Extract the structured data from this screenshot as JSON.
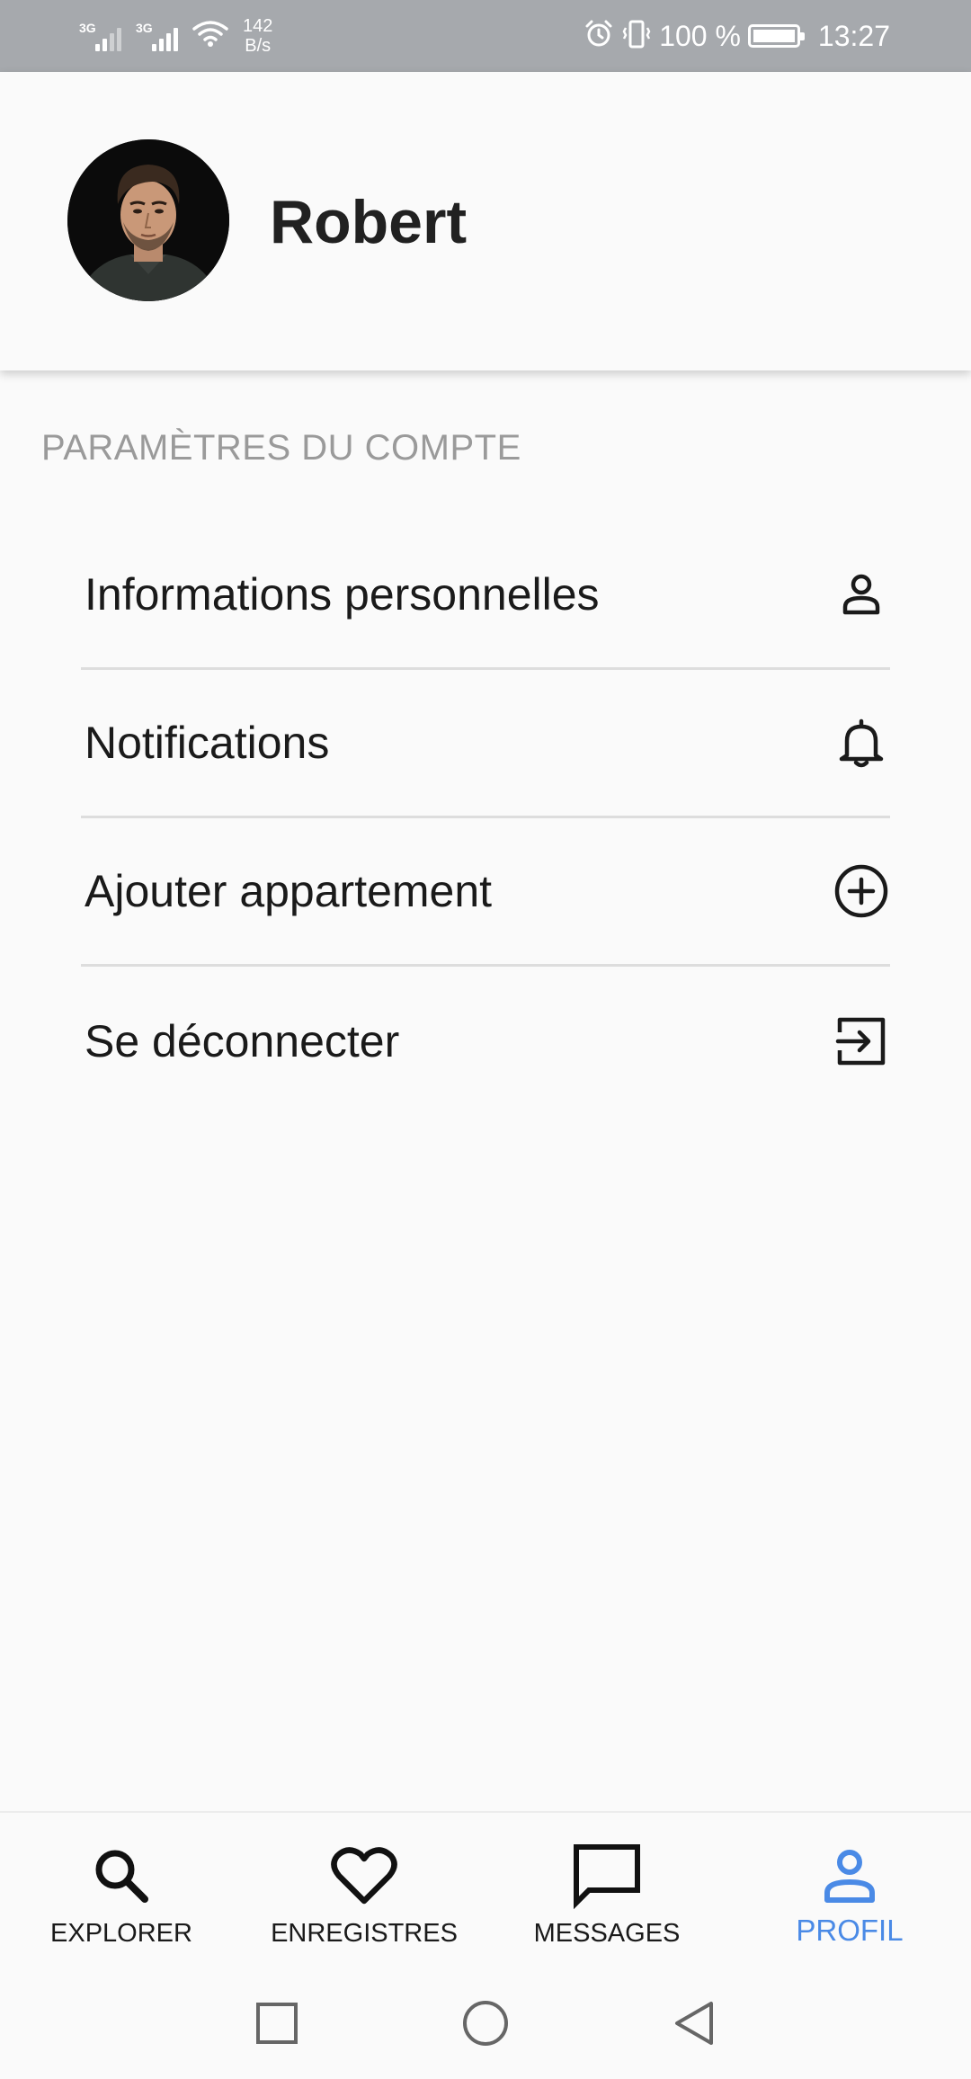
{
  "status_bar": {
    "net_type_1": "3G",
    "net_type_2": "3G",
    "net_speed_value": "142",
    "net_speed_unit": "B/s",
    "battery_percent": "100 %",
    "time": "13:27"
  },
  "profile": {
    "name": "Robert"
  },
  "account_section": {
    "title": "PARAMÈTRES DU COMPTE",
    "items": [
      {
        "label": "Informations personnelles",
        "icon": "person-icon"
      },
      {
        "label": "Notifications",
        "icon": "bell-icon"
      },
      {
        "label": "Ajouter appartement",
        "icon": "add-circle-icon"
      },
      {
        "label": "Se déconnecter",
        "icon": "logout-icon"
      }
    ]
  },
  "bottom_nav": {
    "items": [
      {
        "label": "EXPLORER",
        "icon": "search-icon",
        "active": false
      },
      {
        "label": "ENREGISTRES",
        "icon": "heart-icon",
        "active": false
      },
      {
        "label": "MESSAGES",
        "icon": "chat-icon",
        "active": false
      },
      {
        "label": "PROFIL",
        "icon": "person-icon",
        "active": true
      }
    ]
  },
  "colors": {
    "status_bar_bg": "#a6a9ad",
    "background": "#fafafa",
    "accent": "#4a8ae6",
    "section_title": "#9a9a9a",
    "divider": "#dddddd"
  }
}
